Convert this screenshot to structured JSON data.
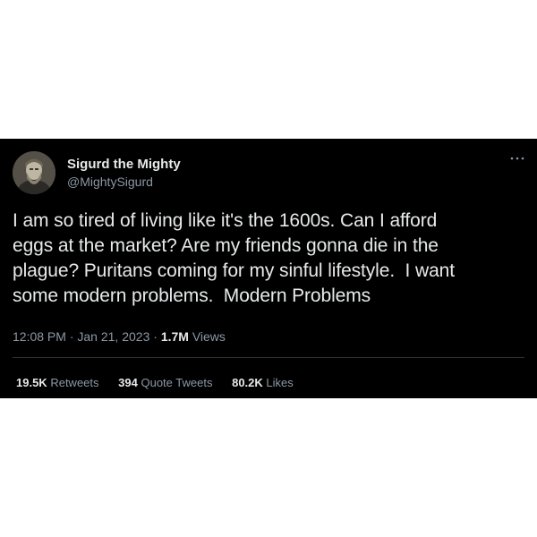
{
  "tweet": {
    "display_name": "Sigurd the Mighty",
    "handle": "@MightySigurd",
    "more_icon": "more-horizontal-icon",
    "text": "I am so tired of living like it's the 1600s. Can I afford\neggs at the market? Are my friends gonna die in the\nplague? Puritans coming for my sinful lifestyle.  I want\nsome modern problems.  Modern Problems",
    "time": "12:08 PM",
    "separator": "·",
    "date": "Jan 21, 2023",
    "views_count": "1.7M",
    "views_label": "Views",
    "stats": {
      "retweets_count": "19.5K",
      "retweets_label": "Retweets",
      "quotes_count": "394",
      "quotes_label": "Quote Tweets",
      "likes_count": "80.2K",
      "likes_label": "Likes"
    }
  },
  "colors": {
    "background": "#000000",
    "primary_text": "#e7e9ea",
    "secondary_text": "#8b98a5"
  }
}
